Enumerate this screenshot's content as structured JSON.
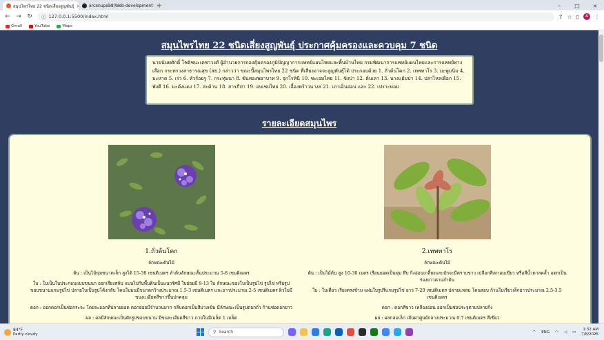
{
  "browser": {
    "tabs": [
      {
        "label": "สมุนไพรไทย 22 ชนิดเสี่ยงสูญพันธุ์",
        "active": true
      },
      {
        "label": "arcanupab8/Web-development",
        "active": false
      }
    ],
    "url": "127.0.0.1:5500/index.html",
    "avatar_letter": "A",
    "bookmarks": [
      "Gmail",
      "YouTube",
      "Maps"
    ]
  },
  "page": {
    "title": "สมุนไพรไทย 22 ชนิดเสี่ยงสูญพันธุ์ ประกาศคุ้มครองและควบคุม 7 ชนิด",
    "intro": "นายนันทศักดิ์ โชติชนะเดชาวงศ์ ผู้อำนวยการกองคุ้มครองภูมิปัญญาการแพทย์แผนไทยและพื้นบ้านไทย กรมพัฒนาการแพทย์แผนไทยและการแพทย์ทางเลือก กระทรวงสาธารณสุข (สธ.) กล่าวว่า ขณะนี้สมุนไพรไทย 22 ชนิด ที่เสี่ยงอาจจะสูญพันธุ์ได้ ประกอบด้วย 1. ถั่วต้นโคก 2. เทพทาโร 3. มะพูมนิ่ม 4. มะหาด 5. เร่ว 6. หัวร้อยรู 7. กระทุ่มนา 8. ขันทองพยาบาท 9. จุกโรหินี 10. ชะเอมไทย 11. ขิงป่า 12. ต้นเลา 13. นางแย้มป่า 14. ปลาไหลเผือก 15. พังคี 16. มะค้งแดง 17. สะค้าน 18. สารภีป่า 19. อบเชยไทย 20. เอื้องพร้าวนางล 21. เถาเอ็นอ่อน และ 22. เปราะหอม",
    "section_title": "รายละเอียดสมุนไพร"
  },
  "herbs": [
    {
      "name": "1.ถั่วต้นโคก",
      "type": "ลักษณะต้นไม้",
      "stem": "ต้น : เป็นไม้พุ่มขนาดเล็ก สูงได้ 15-30 เซนติเมตร ลำต้นลักษณะสั้นประมาณ 5-8 เซนติเมตร",
      "leaf": "ใบ : ใบเป็นใบประกอบแบบขนนก ออกเรียงสลับ แบนไปกับพื้นดินเป็นแนวรัศมี ใบย่อยมี 9-13 ใบ ลักษณะของใบเป็นรูปไข่ รูปไข่ หรือรูปขอบขนานแกมรูปไข่ ปลายใบเป็นรูปโค้งกลับ โคนใบมนมีขนาดกว้างประมาณ 1.5-3 เซนติเมตร และยาวประมาณ 2-5 เซนติเมตร ผิวใบมีขนละเอียดสีขาวขึ้นปกคลุม",
      "flower": "ดอก : ออกดอกเป็นช่อกระจะ โดยจะออกที่ปลายยอด ดอกย่อยมีจำนวนมาก กลีบดอกเป็นสีม่วงเข้ม มีลักษณะเป็นรูปดอกถั่ว ก้านช่อดอกยาว",
      "fruit": "ผล : ผลมีลักษณะเป็นฝักรูปขอบขนาน มีขนละเอียดสีขาว ภายในมีเมล็ด 1 เมล็ด"
    },
    {
      "name": "2.เทพทาโร",
      "type": "ลักษณะต้นไม้",
      "stem": "ต้น : เป็นไม้ต้น สูง 10-30 เมตร เรือนยอดเป็นพุ่ม ทึบ กิ่งอ่อนเกลี้ยงและมักจะมีคราบขาว เปลือกสีเทาอมเขียว หรือสีน้ำตาลคล้ำ แตกเป็นร่องยาวตามลำต้น",
      "leaf": "ใบ : ใบเดี่ยว เรียงตรงข้าม แผ่นใบรูปรีแกมรูปไข่ ยาว 7-20 เซนติเมตร ปลายแหลม โคนสอบ ก้านใบเรียวเล็กยาวประมาณ 2.5-3.5 เซนติเมตร",
      "flower": "ดอก : ดอกสีขาว เหลืองอ่อน ออกเป็นช่อประจุตามปลายกิ่ง",
      "fruit": "ผล : ผลกลมเล็ก เส้นผ่าศูนย์กลางประมาณ 0.7 เซนติเมตร สีเขียว"
    }
  ],
  "taskbar": {
    "temp": "84°F",
    "weather": "Partly cloudy",
    "search_placeholder": "Search",
    "lang": "ENG",
    "time": "1:32 AM",
    "date": "7/8/2025"
  }
}
